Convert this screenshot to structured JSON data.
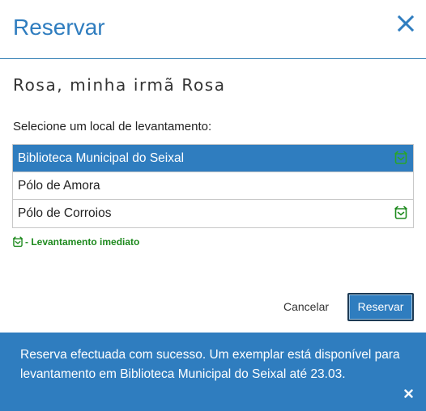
{
  "dialog": {
    "title": "Reservar",
    "close_icon": "close-icon"
  },
  "item": {
    "title": "Rosa, minha irmã Rosa"
  },
  "pickup": {
    "prompt": "Selecione um local de levantamento:",
    "locations": [
      {
        "label": "Biblioteca Municipal do Seixal",
        "selected": true,
        "immediate": true
      },
      {
        "label": "Pólo de Amora",
        "selected": false,
        "immediate": false
      },
      {
        "label": "Pólo de Corroios",
        "selected": false,
        "immediate": true
      }
    ],
    "legend": "- Levantamento imediato",
    "immediate_icon": "alarm-clock-icon"
  },
  "actions": {
    "cancel_label": "Cancelar",
    "reserve_label": "Reservar"
  },
  "notification": {
    "message": "Reserva efectuada com sucesso. Um exemplar está disponível para levantamento em Biblioteca Municipal do Seixal até 23.03.",
    "close_icon": "close-icon"
  },
  "colors": {
    "accent": "#2f7dbf",
    "immediate": "#1e8a1e"
  }
}
